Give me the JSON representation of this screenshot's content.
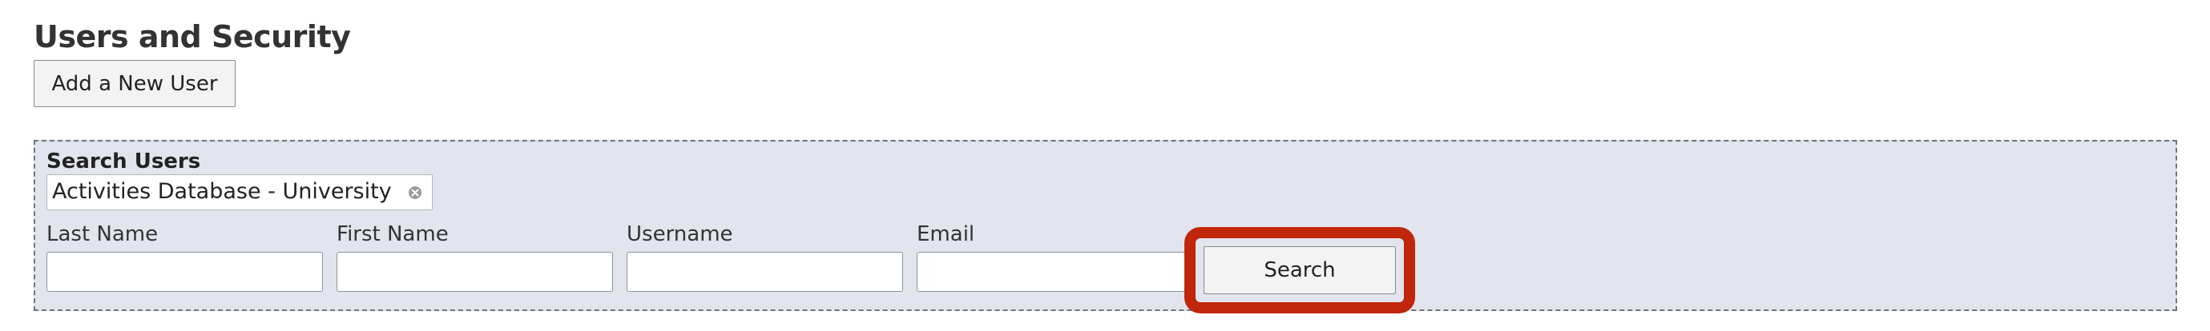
{
  "page": {
    "title": "Users and Security"
  },
  "actions": {
    "add_user_label": "Add a New User"
  },
  "search_panel": {
    "heading": "Search Users",
    "filter": {
      "selected_value": "Activities Database - University",
      "clear_icon": "clear-circle-icon"
    },
    "fields": {
      "last_name": {
        "label": "Last Name",
        "value": ""
      },
      "first_name": {
        "label": "First Name",
        "value": ""
      },
      "username": {
        "label": "Username",
        "value": ""
      },
      "email": {
        "label": "Email",
        "value": ""
      }
    },
    "search_label": "Search",
    "highlight_color": "#c0260c"
  },
  "colors": {
    "panel_background": "#e2e5ee",
    "panel_border": "#6e7380",
    "button_background": "#f3f3f3"
  }
}
